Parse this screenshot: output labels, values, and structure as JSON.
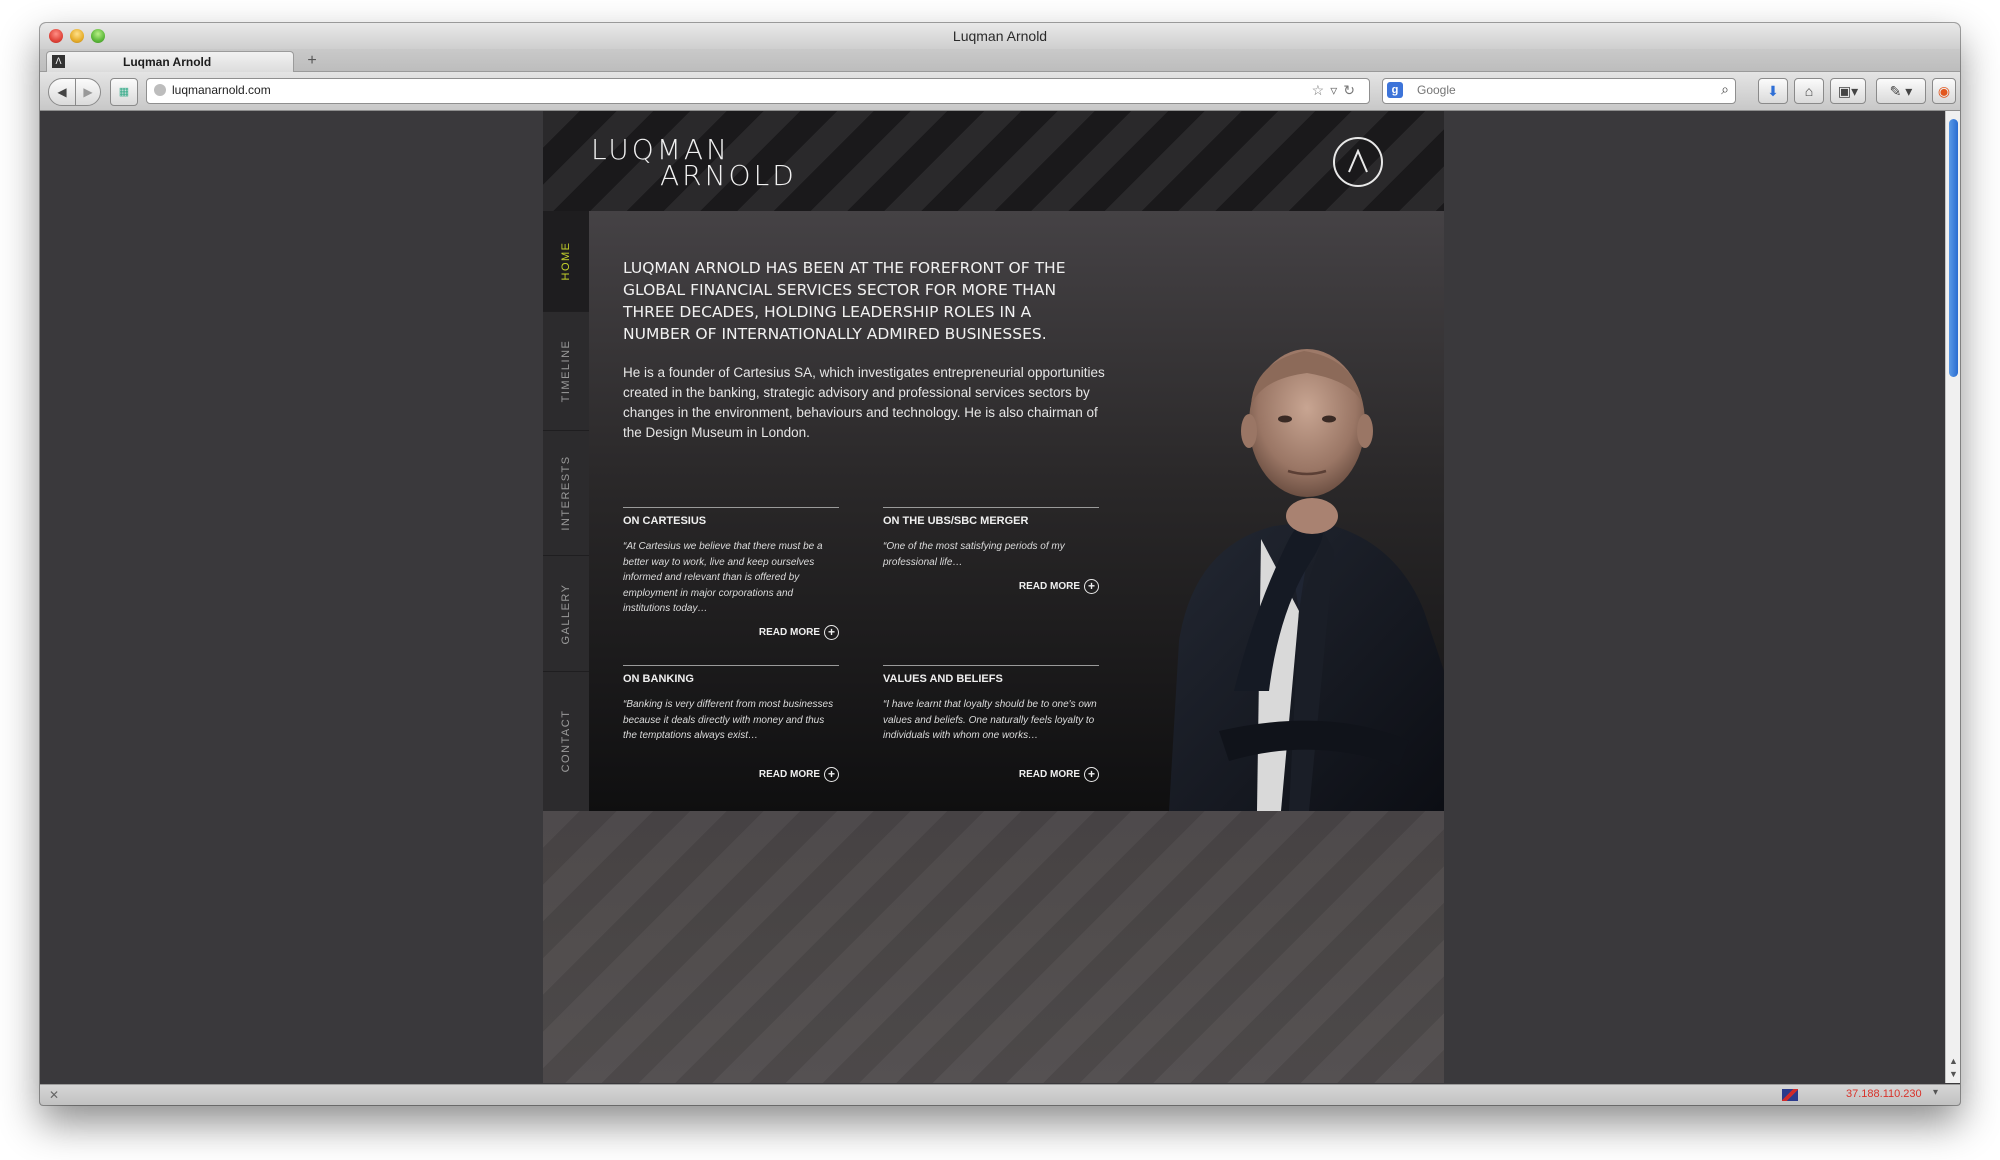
{
  "browser": {
    "window_title": "Luqman Arnold",
    "tab_title": "Luqman Arnold",
    "new_tab_label": "+",
    "url": "luqmanarnold.com",
    "search_placeholder": "Google",
    "status_ip": "37.188.110.230"
  },
  "site": {
    "logo_line1": "LUQMAN",
    "logo_line2": "ARNOLD",
    "nav": [
      {
        "label": "HOME",
        "active": true
      },
      {
        "label": "TIMELINE",
        "active": false
      },
      {
        "label": "INTERESTS",
        "active": false
      },
      {
        "label": "GALLERY",
        "active": false
      },
      {
        "label": "CONTACT",
        "active": false
      }
    ],
    "intro_heading": "LUQMAN ARNOLD HAS BEEN AT THE FOREFRONT OF THE GLOBAL FINANCIAL SERVICES SECTOR FOR MORE THAN THREE DECADES, HOLDING LEADERSHIP ROLES IN A NUMBER OF INTERNATIONALLY ADMIRED BUSINESSES.",
    "intro_body": "He is a founder of Cartesius SA, which investigates entrepreneurial opportunities created in the banking, strategic advisory and professional services sectors by changes in the environment, behaviours and technology. He is also chairman of the Design Museum in London.",
    "quotes": [
      {
        "title": "ON CARTESIUS",
        "text": "“At Cartesius we believe that there must be a better way to work, live and keep ourselves informed and relevant than is offered by employment in major corporations and institutions today…",
        "link": "READ MORE"
      },
      {
        "title": "ON THE UBS/SBC MERGER",
        "text": "“One of the most satisfying periods of my professional life…",
        "link": "READ MORE"
      },
      {
        "title": "ON BANKING",
        "text": "“Banking is very different from most businesses because it deals directly with money and thus the temptations always exist…",
        "link": "READ MORE"
      },
      {
        "title": "VALUES AND BELIEFS",
        "text": "“I have learnt that loyalty should be to one's own values and beliefs. One naturally feels loyalty to individuals with whom one works…",
        "link": "READ MORE"
      }
    ],
    "accent_color": "#c5d22a"
  }
}
